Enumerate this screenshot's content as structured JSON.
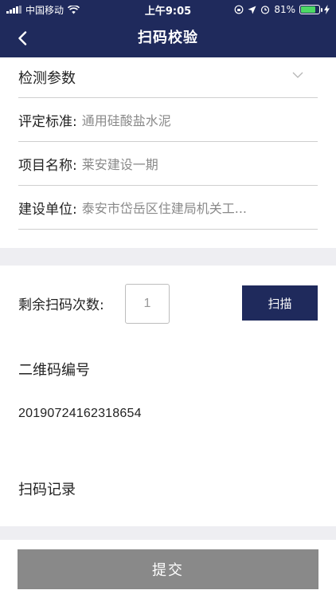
{
  "status_bar": {
    "carrier": "中国移动",
    "time": "上午9:05",
    "battery": "81%",
    "battery_level": 0.81
  },
  "nav": {
    "title": "扫码校验",
    "back_icon": "chevron-left-icon"
  },
  "form": {
    "param_label": "检测参数",
    "standard_label": "评定标准:",
    "standard_value": "通用硅酸盐水泥",
    "project_label": "项目名称:",
    "project_value": "莱安建设一期",
    "unit_label": "建设单位:",
    "unit_value": "泰安市岱岳区住建局机关工..."
  },
  "scan": {
    "count_label": "剩余扫码次数:",
    "count_value": "1",
    "scan_button": "扫描"
  },
  "qr": {
    "label": "二维码编号",
    "value": "20190724162318654"
  },
  "record": {
    "label": "扫码记录"
  },
  "submit": {
    "label": "提交"
  },
  "colors": {
    "header": "#1f2a5c",
    "submit": "#898989",
    "divider": "#cfcfcf",
    "section_gap": "#eeeef2"
  }
}
